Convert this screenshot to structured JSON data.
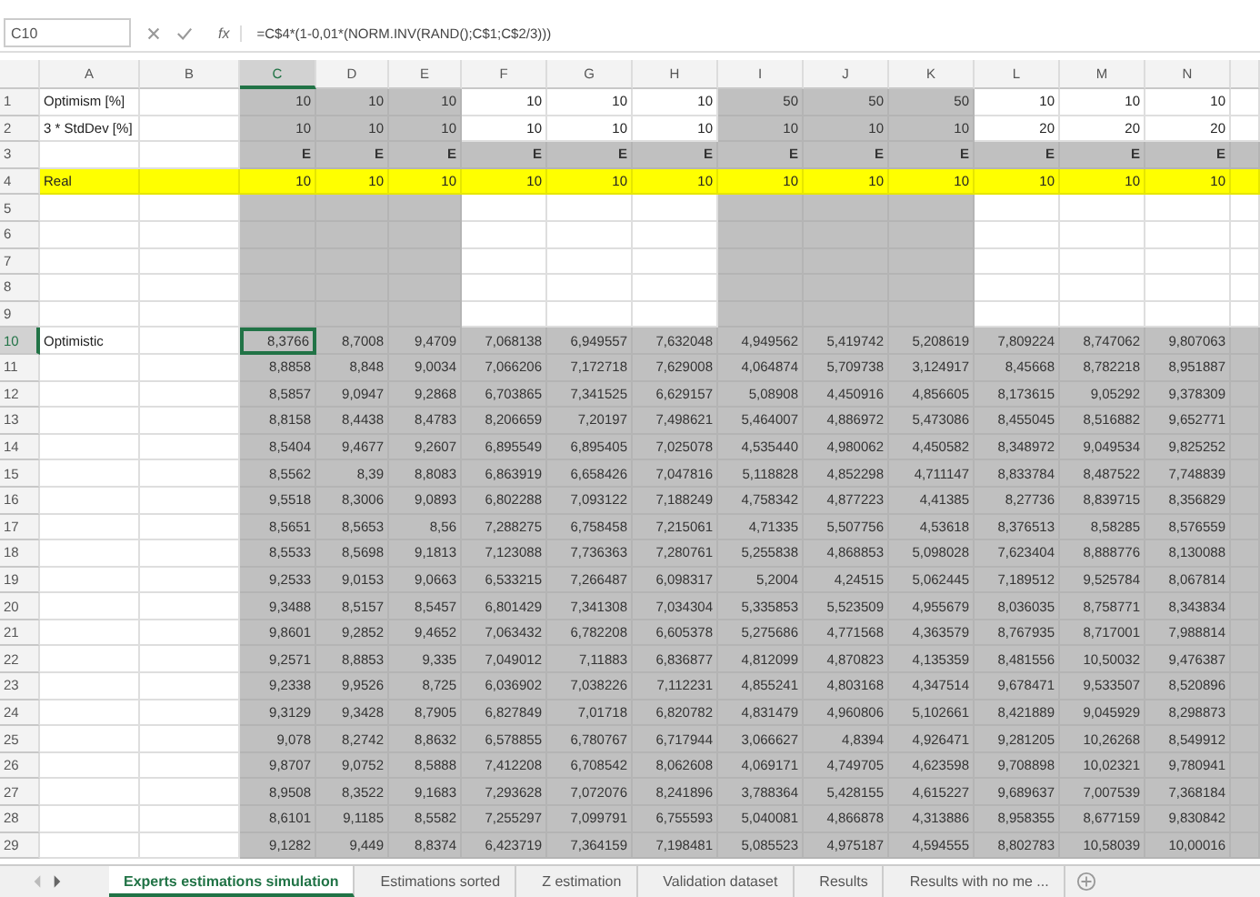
{
  "name_box": "C10",
  "function_label": "fx",
  "formula": "=C$4*(1-0,01*(NORM.INV(RAND();C$1;C$2/3)))",
  "columns": [
    {
      "label": "A",
      "selected": false,
      "shaded": false
    },
    {
      "label": "B",
      "selected": false,
      "shaded": false
    },
    {
      "label": "C",
      "selected": true,
      "shaded": true
    },
    {
      "label": "D",
      "selected": false,
      "shaded": true
    },
    {
      "label": "E",
      "selected": false,
      "shaded": true
    },
    {
      "label": "F",
      "selected": false,
      "shaded": false
    },
    {
      "label": "G",
      "selected": false,
      "shaded": false
    },
    {
      "label": "H",
      "selected": false,
      "shaded": false
    },
    {
      "label": "I",
      "selected": false,
      "shaded": true
    },
    {
      "label": "J",
      "selected": false,
      "shaded": true
    },
    {
      "label": "K",
      "selected": false,
      "shaded": true
    },
    {
      "label": "L",
      "selected": false,
      "shaded": false
    },
    {
      "label": "M",
      "selected": false,
      "shaded": false
    },
    {
      "label": "N",
      "selected": false,
      "shaded": false
    }
  ],
  "rows": [
    {
      "number": "1",
      "kind": "param",
      "selected": false,
      "label": "Optimism [%]",
      "values": [
        "10",
        "10",
        "10",
        "10",
        "10",
        "10",
        "50",
        "50",
        "50",
        "10",
        "10",
        "10"
      ]
    },
    {
      "number": "2",
      "kind": "param",
      "selected": false,
      "label": "3 * StdDev [%]",
      "values": [
        "10",
        "10",
        "10",
        "10",
        "10",
        "10",
        "10",
        "10",
        "10",
        "20",
        "20",
        "20"
      ]
    },
    {
      "number": "3",
      "kind": "marker",
      "selected": false,
      "values": [
        "E",
        "E",
        "E",
        "E",
        "E",
        "E",
        "E",
        "E",
        "E",
        "E",
        "E",
        "E"
      ]
    },
    {
      "number": "4",
      "kind": "real",
      "selected": false,
      "label": "Real",
      "values": [
        "10",
        "10",
        "10",
        "10",
        "10",
        "10",
        "10",
        "10",
        "10",
        "10",
        "10",
        "10"
      ]
    },
    {
      "number": "5",
      "kind": "blank",
      "selected": false
    },
    {
      "number": "6",
      "kind": "blank",
      "selected": false
    },
    {
      "number": "7",
      "kind": "blank",
      "selected": false
    },
    {
      "number": "8",
      "kind": "blank",
      "selected": false
    },
    {
      "number": "9",
      "kind": "blank",
      "selected": false
    },
    {
      "number": "10",
      "kind": "data",
      "selected": true,
      "label": "Optimistic",
      "values": [
        "8,3766",
        "8,7008",
        "9,4709",
        "7,068138",
        "6,949557",
        "7,632048",
        "4,949562",
        "5,419742",
        "5,208619",
        "7,809224",
        "8,747062",
        "9,807063"
      ]
    },
    {
      "number": "11",
      "kind": "data",
      "selected": false,
      "values": [
        "8,8858",
        "8,848",
        "9,0034",
        "7,066206",
        "7,172718",
        "7,629008",
        "4,064874",
        "5,709738",
        "3,124917",
        "8,45668",
        "8,782218",
        "8,951887"
      ]
    },
    {
      "number": "12",
      "kind": "data",
      "selected": false,
      "values": [
        "8,5857",
        "9,0947",
        "9,2868",
        "6,703865",
        "7,341525",
        "6,629157",
        "5,08908",
        "4,450916",
        "4,856605",
        "8,173615",
        "9,05292",
        "9,378309"
      ]
    },
    {
      "number": "13",
      "kind": "data",
      "selected": false,
      "values": [
        "8,8158",
        "8,4438",
        "8,4783",
        "8,206659",
        "7,20197",
        "7,498621",
        "5,464007",
        "4,886972",
        "5,473086",
        "8,455045",
        "8,516882",
        "9,652771"
      ]
    },
    {
      "number": "14",
      "kind": "data",
      "selected": false,
      "values": [
        "8,5404",
        "9,4677",
        "9,2607",
        "6,895549",
        "6,895405",
        "7,025078",
        "4,535440",
        "4,980062",
        "4,450582",
        "8,348972",
        "9,049534",
        "9,825252"
      ]
    },
    {
      "number": "15",
      "kind": "data",
      "selected": false,
      "values": [
        "8,5562",
        "8,39",
        "8,8083",
        "6,863919",
        "6,658426",
        "7,047816",
        "5,118828",
        "4,852298",
        "4,711147",
        "8,833784",
        "8,487522",
        "7,748839"
      ]
    },
    {
      "number": "16",
      "kind": "data",
      "selected": false,
      "values": [
        "9,5518",
        "8,3006",
        "9,0893",
        "6,802288",
        "7,093122",
        "7,188249",
        "4,758342",
        "4,877223",
        "4,41385",
        "8,27736",
        "8,839715",
        "8,356829"
      ]
    },
    {
      "number": "17",
      "kind": "data",
      "selected": false,
      "values": [
        "8,5651",
        "8,5653",
        "8,56",
        "7,288275",
        "6,758458",
        "7,215061",
        "4,71335",
        "5,507756",
        "4,53618",
        "8,376513",
        "8,58285",
        "8,576559"
      ]
    },
    {
      "number": "18",
      "kind": "data",
      "selected": false,
      "values": [
        "8,5533",
        "8,5698",
        "9,1813",
        "7,123088",
        "7,736363",
        "7,280761",
        "5,255838",
        "4,868853",
        "5,098028",
        "7,623404",
        "8,888776",
        "8,130088"
      ]
    },
    {
      "number": "19",
      "kind": "data",
      "selected": false,
      "values": [
        "9,2533",
        "9,0153",
        "9,0663",
        "6,533215",
        "7,266487",
        "6,098317",
        "5,2004",
        "4,24515",
        "5,062445",
        "7,189512",
        "9,525784",
        "8,067814"
      ]
    },
    {
      "number": "20",
      "kind": "data",
      "selected": false,
      "values": [
        "9,3488",
        "8,5157",
        "8,5457",
        "6,801429",
        "7,341308",
        "7,034304",
        "5,335853",
        "5,523509",
        "4,955679",
        "8,036035",
        "8,758771",
        "8,343834"
      ]
    },
    {
      "number": "21",
      "kind": "data",
      "selected": false,
      "values": [
        "9,8601",
        "9,2852",
        "9,4652",
        "7,063432",
        "6,782208",
        "6,605378",
        "5,275686",
        "4,771568",
        "4,363579",
        "8,767935",
        "8,717001",
        "7,988814"
      ]
    },
    {
      "number": "22",
      "kind": "data",
      "selected": false,
      "values": [
        "9,2571",
        "8,8853",
        "9,335",
        "7,049012",
        "7,11883",
        "6,836877",
        "4,812099",
        "4,870823",
        "4,135359",
        "8,481556",
        "10,50032",
        "9,476387"
      ]
    },
    {
      "number": "23",
      "kind": "data",
      "selected": false,
      "values": [
        "9,2338",
        "9,9526",
        "8,725",
        "6,036902",
        "7,038226",
        "7,112231",
        "4,855241",
        "4,803168",
        "4,347514",
        "9,678471",
        "9,533507",
        "8,520896"
      ]
    },
    {
      "number": "24",
      "kind": "data",
      "selected": false,
      "values": [
        "9,3129",
        "9,3428",
        "8,7905",
        "6,827849",
        "7,01718",
        "6,820782",
        "4,831479",
        "4,960806",
        "5,102661",
        "8,421889",
        "9,045929",
        "8,298873"
      ]
    },
    {
      "number": "25",
      "kind": "data",
      "selected": false,
      "values": [
        "9,078",
        "8,2742",
        "8,8632",
        "6,578855",
        "6,780767",
        "6,717944",
        "3,066627",
        "4,8394",
        "4,926471",
        "9,281205",
        "10,26268",
        "8,549912"
      ]
    },
    {
      "number": "26",
      "kind": "data",
      "selected": false,
      "values": [
        "9,8707",
        "9,0752",
        "8,5888",
        "7,412208",
        "6,708542",
        "8,062608",
        "4,069171",
        "4,749705",
        "4,623598",
        "9,708898",
        "10,02321",
        "9,780941"
      ]
    },
    {
      "number": "27",
      "kind": "data",
      "selected": false,
      "values": [
        "8,9508",
        "8,3522",
        "9,1683",
        "7,293628",
        "7,072076",
        "8,241896",
        "3,788364",
        "5,428155",
        "4,615227",
        "9,689637",
        "7,007539",
        "7,368184"
      ]
    },
    {
      "number": "28",
      "kind": "data",
      "selected": false,
      "values": [
        "8,6101",
        "9,1185",
        "8,5582",
        "7,255297",
        "7,099791",
        "6,755593",
        "5,040081",
        "4,866878",
        "4,313886",
        "8,958355",
        "8,677159",
        "9,830842"
      ]
    },
    {
      "number": "29",
      "kind": "data",
      "selected": false,
      "values": [
        "9,1282",
        "9,449",
        "8,8374",
        "6,423719",
        "7,364159",
        "7,198481",
        "5,085523",
        "4,975187",
        "4,594555",
        "8,802783",
        "10,58039",
        "10,00016"
      ]
    }
  ],
  "sheet_tabs": [
    {
      "label": "Experts estimations simulation",
      "selected": true
    },
    {
      "label": "Estimations sorted",
      "selected": false
    },
    {
      "label": "Z estimation",
      "selected": false
    },
    {
      "label": "Validation dataset",
      "selected": false
    },
    {
      "label": "Results",
      "selected": false
    },
    {
      "label": "Results with no me ...",
      "selected": false
    }
  ]
}
